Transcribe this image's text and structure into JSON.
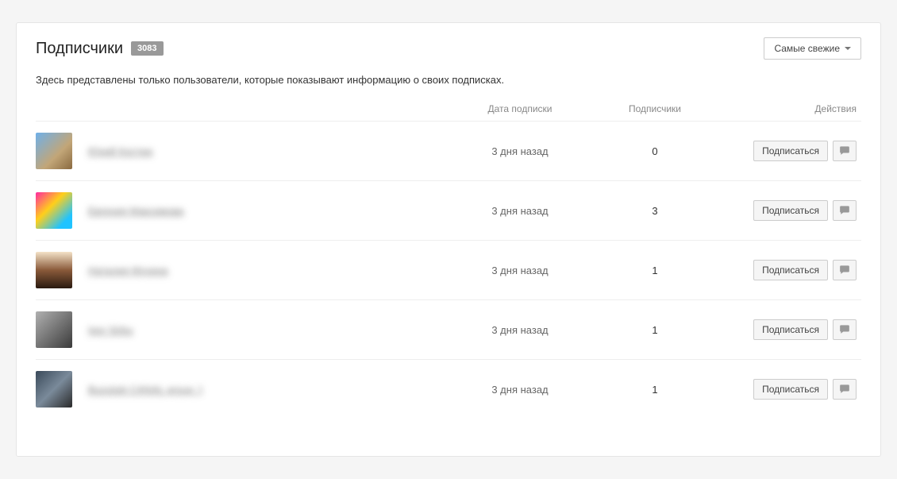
{
  "header": {
    "title": "Подписчики",
    "count": "3083",
    "sort_label": "Самые свежие"
  },
  "subtext": "Здесь представлены только пользователи, которые показывают информацию о своих подписках.",
  "columns": {
    "date": "Дата подписки",
    "subscribers": "Подписчики",
    "actions": "Действия"
  },
  "labels": {
    "subscribe": "Подписаться"
  },
  "rows": [
    {
      "name": "Юрий Костюк",
      "date": "3 дня назад",
      "subs": "0",
      "avatar_class": "av1"
    },
    {
      "name": "Евгения Максимова",
      "date": "3 дня назад",
      "subs": "3",
      "avatar_class": "av2"
    },
    {
      "name": "Наталия Мухина",
      "date": "3 дня назад",
      "subs": "1",
      "avatar_class": "av3"
    },
    {
      "name": "Igor Sirbu",
      "date": "3 дня назад",
      "subs": "1",
      "avatar_class": "av4"
    },
    {
      "name": "Buzuluki CANAL group :)",
      "date": "3 дня назад",
      "subs": "1",
      "avatar_class": "av5"
    }
  ]
}
